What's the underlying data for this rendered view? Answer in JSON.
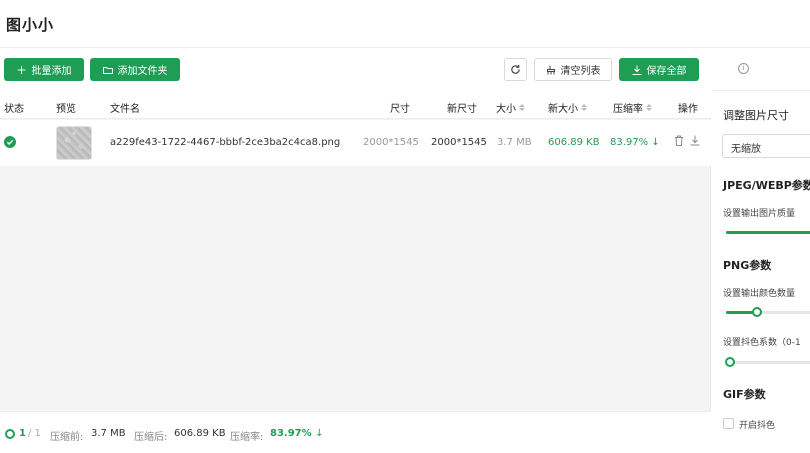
{
  "app": {
    "title": "图小小"
  },
  "toolbar": {
    "batch_add_label": "批量添加",
    "add_folder_label": "添加文件夹",
    "clear_list_label": "清空列表",
    "save_all_label": "保存全部"
  },
  "table": {
    "headers": {
      "status": "状态",
      "preview": "预览",
      "filename": "文件名",
      "size": "尺寸",
      "new_size": "新尺寸",
      "filesize": "大小",
      "new_filesize": "新大小",
      "ratio": "压缩率",
      "actions": "操作"
    },
    "rows": [
      {
        "filename": "a229fe43-1722-4467-bbbf-2ce3ba2c4ca8.png",
        "size": "2000*1545",
        "new_size": "2000*1545",
        "filesize": "3.7 MB",
        "new_filesize": "606.89 KB",
        "ratio": "83.97%"
      }
    ]
  },
  "footer": {
    "count": "1",
    "total": "/ 1",
    "before_label": "压缩前:",
    "before_value": "3.7 MB",
    "after_label": "压缩后:",
    "after_value": "606.89 KB",
    "ratio_label": "压缩率:",
    "ratio_value": "83.97%"
  },
  "sidebar": {
    "resize_label": "调整图片尺寸",
    "resize_option": "无缩放",
    "jpeg_heading": "JPEG/WEBP参数",
    "quality_label": "设置输出图片质量",
    "png_heading": "PNG参数",
    "colors_label": "设置输出颜色数量",
    "dither_label": "设置抖色系数（0-1",
    "gif_heading": "GIF参数",
    "gif_dither_label": "开启抖色",
    "quality_level": 0.8,
    "colors_level": 0.22,
    "dither_level": 0.0
  },
  "colors": {
    "accent": "#1f9d55"
  }
}
